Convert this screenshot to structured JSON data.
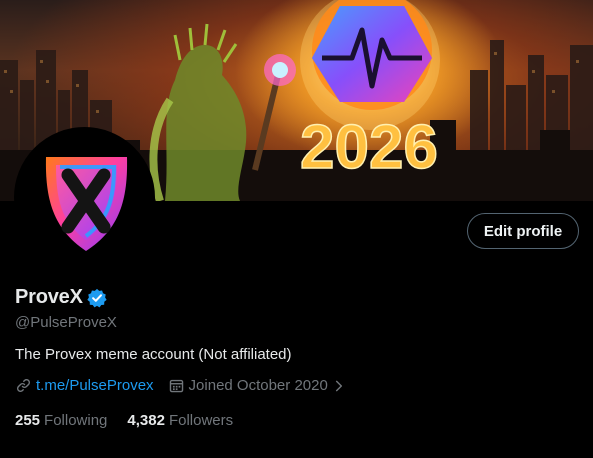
{
  "banner": {
    "year_text": "2026"
  },
  "header": {
    "edit_profile_label": "Edit profile"
  },
  "profile": {
    "display_name": "ProveX",
    "handle": "@PulseProveX",
    "bio": "The Provex meme account (Not affiliated)",
    "link_text": "t.me/PulseProvex",
    "joined_text": "Joined October 2020",
    "verified": true
  },
  "stats": {
    "following_count": "255",
    "following_label": "Following",
    "followers_count": "4,382",
    "followers_label": "Followers"
  },
  "colors": {
    "background": "#000000",
    "text_primary": "#e7e9ea",
    "text_secondary": "#71767b",
    "link": "#1d9bf0",
    "verified_badge": "#1d9bf0",
    "button_border": "#536471"
  },
  "icons": {
    "verified": "verified-badge-icon",
    "link": "link-icon",
    "calendar": "calendar-icon",
    "chevron": "chevron-right-icon"
  }
}
